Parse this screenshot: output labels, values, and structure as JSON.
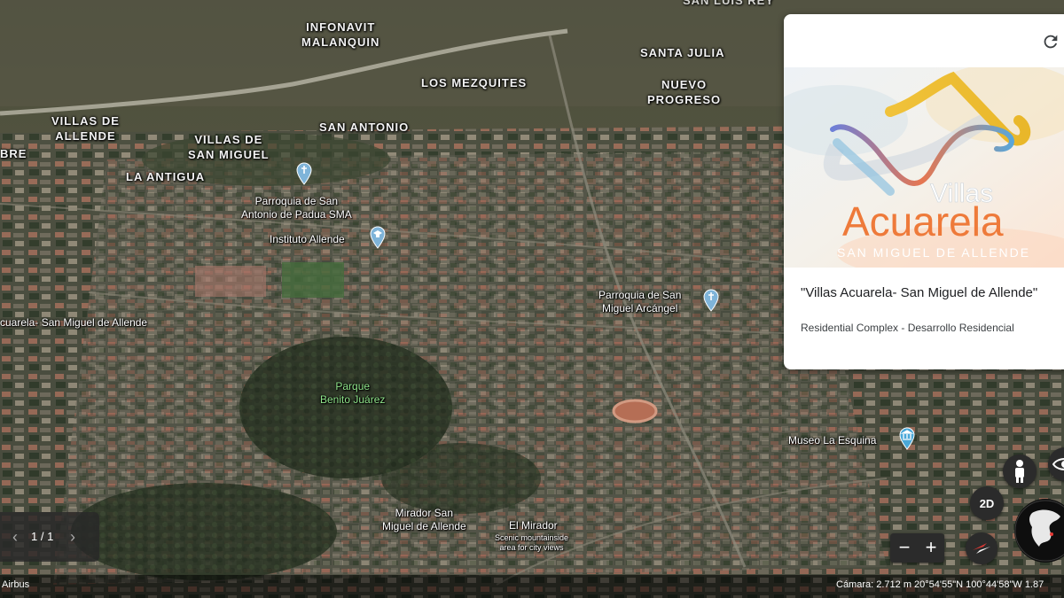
{
  "places": {
    "infonavit": [
      "INFONAVIT",
      "MALANQUIN"
    ],
    "santa_julia": "SANTA JULIA",
    "nuevo_progreso": [
      "NUEVO",
      "PROGRESO"
    ],
    "los_mezquites": "LOS MEZQUITES",
    "san_antonio": "SAN ANTONIO",
    "villas_allende": [
      "VILLAS DE",
      "ALLENDE"
    ],
    "villas_san_miguel": [
      "VILLAS DE",
      "SAN MIGUEL"
    ],
    "la_antigua": "LA ANTIGUA",
    "left_edge": "BRE",
    "top_partial": "SAN LUIS REY"
  },
  "pois": {
    "parroquia_padua": [
      "Parroquia de San",
      "Antonio de Padua SMA"
    ],
    "instituto_allende": "Instituto Allende",
    "parroquia_arcangel": [
      "Parroquia de San",
      "Miguel Arcángel"
    ],
    "villas_acuarela_label": "cuarela- San Miguel de Allende",
    "parque": [
      "Parque",
      "Benito Juárez"
    ],
    "museo": "Museo La Esquina",
    "mirador_sma": [
      "Mirador San",
      "Miguel de Allende"
    ],
    "el_mirador": "El Mirador",
    "el_mirador_desc": [
      "Scenic mountainside",
      "area for city views"
    ]
  },
  "card": {
    "logo_line1": "Villas",
    "logo_line2": "Acuarela",
    "logo_line3": "SAN MIGUEL DE ALLENDE",
    "title": "\"Villas Acuarela- San Miguel de Allende\"",
    "subtitle": "Residential Complex - Desarrollo Residencial"
  },
  "pager": {
    "text": "1 / 1",
    "prev": "‹",
    "next": "›"
  },
  "controls": {
    "mode": "2D",
    "zoom_out": "−",
    "zoom_in": "+"
  },
  "footer": {
    "attribution": "Airbus",
    "camera": "Cámara: 2.712 m  20°54'55\"N 100°44'58\"W  1.87"
  },
  "icons": [
    "refresh-icon",
    "church-pin-icon",
    "school-pin-icon",
    "museum-pin-icon",
    "pegman-icon",
    "eye-icon",
    "compass-icon",
    "globe-icon",
    "chevron-left-icon",
    "chevron-right-icon"
  ],
  "colors": {
    "park_label": "#8fe38a",
    "pin_blue": "#7fb4d9",
    "museum_pin": "#4aa8d8",
    "logo_orange": "#ee7a3a"
  }
}
